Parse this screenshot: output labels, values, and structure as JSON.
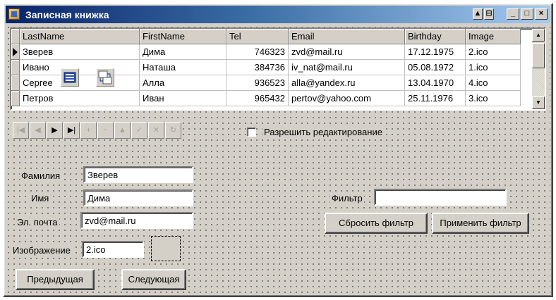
{
  "window": {
    "title": "Записная книжка",
    "controls": {
      "minimize": "_",
      "maximize": "□",
      "close": "×"
    }
  },
  "grid": {
    "columns": [
      "LastName",
      "FirstName",
      "Tel",
      "Email",
      "Birthday",
      "Image"
    ],
    "rows": [
      [
        "Зверев",
        "Дима",
        "746323",
        "zvd@mail.ru",
        "17.12.1975",
        "2.ico"
      ],
      [
        "Ивано",
        "Наташа",
        "384736",
        "iv_nat@mail.ru",
        "05.08.1972",
        "1.ico"
      ],
      [
        "Сергее",
        "Алла",
        "936523",
        "alla@yandex.ru",
        "13.04.1970",
        "4.ico"
      ],
      [
        "Петров",
        "Иван",
        "965432",
        "pertov@yahoo.com",
        "25.11.1976",
        "3.ico"
      ]
    ],
    "current_row": 0
  },
  "navigator": {
    "buttons": [
      {
        "name": "first",
        "glyph": "|◀",
        "enabled": false
      },
      {
        "name": "prior",
        "glyph": "◀",
        "enabled": false
      },
      {
        "name": "next",
        "glyph": "▶",
        "enabled": true
      },
      {
        "name": "last",
        "glyph": "▶|",
        "enabled": true
      },
      {
        "name": "insert",
        "glyph": "+",
        "enabled": false
      },
      {
        "name": "delete",
        "glyph": "−",
        "enabled": false
      },
      {
        "name": "edit",
        "glyph": "▲",
        "enabled": false
      },
      {
        "name": "post",
        "glyph": "✓",
        "enabled": false
      },
      {
        "name": "cancel",
        "glyph": "✕",
        "enabled": false
      },
      {
        "name": "refresh",
        "glyph": "↻",
        "enabled": false
      }
    ]
  },
  "edit_toggle": {
    "label": "Разрешить редактирование",
    "checked": false
  },
  "form": {
    "lastname_label": "Фамилия",
    "lastname_value": "Зверев",
    "firstname_label": "Имя",
    "firstname_value": "Дима",
    "email_label": "Эл. почта",
    "email_value": "zvd@mail.ru",
    "image_label": "Изображение",
    "image_value": "2.ico",
    "filter_label": "Фильтр",
    "filter_value": ""
  },
  "buttons": {
    "reset_filter": "Сбросить фильтр",
    "apply_filter": "Применить фильтр",
    "prev": "Предыдущая",
    "next": "Следующая"
  }
}
